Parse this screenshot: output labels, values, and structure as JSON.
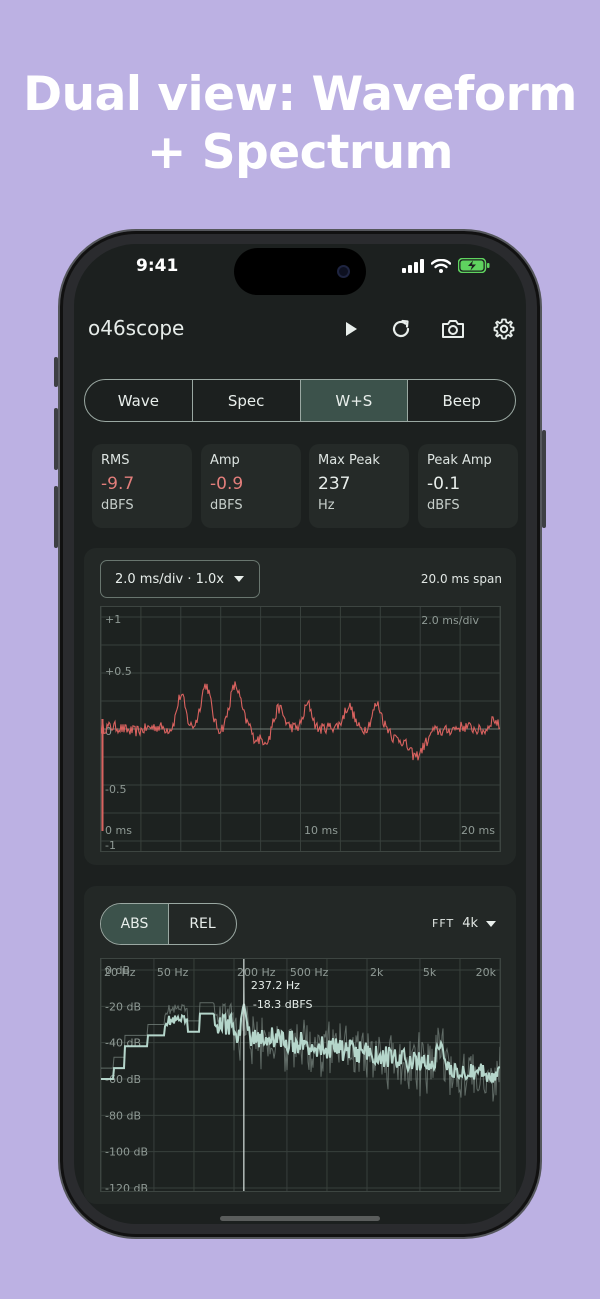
{
  "headline": [
    "Dual view: Waveform",
    "+ Spectrum"
  ],
  "status": {
    "time": "9:41"
  },
  "app": {
    "title": "o46scope"
  },
  "icons": {
    "play": "play-icon",
    "refresh": "refresh-icon",
    "camera": "camera-icon",
    "settings": "gear-icon"
  },
  "modes": [
    "Wave",
    "Spec",
    "W+S",
    "Beep"
  ],
  "active_mode": "W+S",
  "metrics": [
    {
      "label": "RMS",
      "value": "-9.7",
      "unit": "dBFS",
      "warn": true
    },
    {
      "label": "Amp",
      "value": "-0.9",
      "unit": "dBFS",
      "warn": true
    },
    {
      "label": "Max Peak",
      "value": "237",
      "unit": "Hz",
      "warn": false
    },
    {
      "label": "Peak Amp",
      "value": "-0.1",
      "unit": "dBFS",
      "warn": false
    }
  ],
  "waveform": {
    "timebase": "2.0 ms/div · 1.0x",
    "span": "20.0 ms span",
    "div_label": "2.0 ms/div",
    "y_labels": [
      "+1",
      "+0.5",
      "0",
      "-0.5",
      "-1"
    ],
    "x_labels": [
      "0 ms",
      "10 ms",
      "20 ms"
    ]
  },
  "spectrum": {
    "abs_label": "ABS",
    "rel_label": "REL",
    "fft_label": "FFT",
    "fft_size": "4k",
    "freq_labels": [
      "20 Hz",
      "50 Hz",
      "200 Hz",
      "500 Hz",
      "2k",
      "5k",
      "20k"
    ],
    "db_labels": [
      "0 dB",
      "-20 dB",
      "-40 dB",
      "-60 dB",
      "-80 dB",
      "-100 dB",
      "-120 dB"
    ],
    "marker_freq": "237.2 Hz",
    "marker_level": "-18.3 dBFS"
  },
  "colors": {
    "accent": "#3c524b",
    "warn": "#e27e7b",
    "wave": "#d9625f",
    "spectrum": "#b5d6cb"
  }
}
